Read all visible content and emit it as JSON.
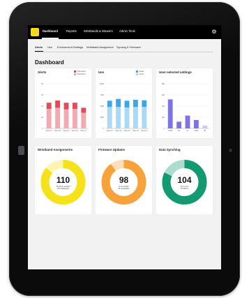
{
  "nav": {
    "items": [
      "Dashboard",
      "Reports",
      "Wristbands & Wearers",
      "Admin Tools"
    ],
    "active": "Dashboard"
  },
  "subnav": {
    "items": [
      "Alerts",
      "Use",
      "Environment Settings",
      "Wristband Assignment",
      "Syncing & Firmware"
    ],
    "active": "Alerts"
  },
  "page": {
    "title": "Dashboard"
  },
  "colors": {
    "alerts_high": "#e34a5a",
    "alerts_low": "#f4a8b0",
    "use_dark": "#3ea6e3",
    "use_light": "#a9d9f6",
    "selected": "#7c73e6",
    "selected_light": "#cfc8f6",
    "yellow": "#f5e21a",
    "orange": "#f7a23a",
    "green": "#139a72"
  },
  "chart_data": [
    {
      "type": "bar",
      "title": "Alerts",
      "categories": [
        "Week 13",
        "Week 14",
        "Week 15",
        "Week 16",
        "Week 17"
      ],
      "series": [
        {
          "name": "High Alerts",
          "values": [
            11,
            13,
            12,
            11,
            9
          ]
        },
        {
          "name": "Total Alerts",
          "values": [
            35,
            37,
            34,
            35,
            28
          ]
        }
      ],
      "stacked": true,
      "ylim": [
        0,
        80
      ],
      "yticks": [
        "0",
        "20",
        "40",
        "60",
        "80"
      ]
    },
    {
      "type": "bar",
      "title": "Use",
      "categories": [
        "Week 13",
        "Week 14",
        "Week 15",
        "Week 16",
        "Week 17"
      ],
      "series": [
        {
          "name": "Wears",
          "values": [
            14,
            18,
            15,
            16,
            15
          ]
        },
        {
          "name": "Syncs",
          "values": [
            48,
            48,
            47,
            48,
            48
          ]
        }
      ],
      "stacked": true,
      "ylim": [
        0,
        100
      ],
      "yticks": [
        "0",
        "2500",
        "5000",
        "7500",
        "10000"
      ]
    },
    {
      "type": "bar",
      "title": "User-selected settings",
      "categories": [
        "HWM",
        "SH",
        "DT",
        "MWE",
        "BK"
      ],
      "values": [
        520,
        120,
        230,
        150,
        50
      ],
      "ylim": [
        0,
        800
      ],
      "yticks": [
        "0",
        "200",
        "400",
        "600",
        "800"
      ]
    }
  ],
  "donuts": [
    {
      "title": "Wristband Assignments",
      "value": "110",
      "sub1": "75 active wearers",
      "sub2": "35 unassigned",
      "fraction": 0.86
    },
    {
      "title": "Firmware Updates",
      "value": "98",
      "sub1": "8 out of date",
      "sub2": "90 unupdated",
      "fraction": 0.9
    },
    {
      "title": "Data Synching",
      "value": "104",
      "sub1": "94 in sync",
      "sub2": "10 offsync",
      "fraction": 0.82
    }
  ]
}
